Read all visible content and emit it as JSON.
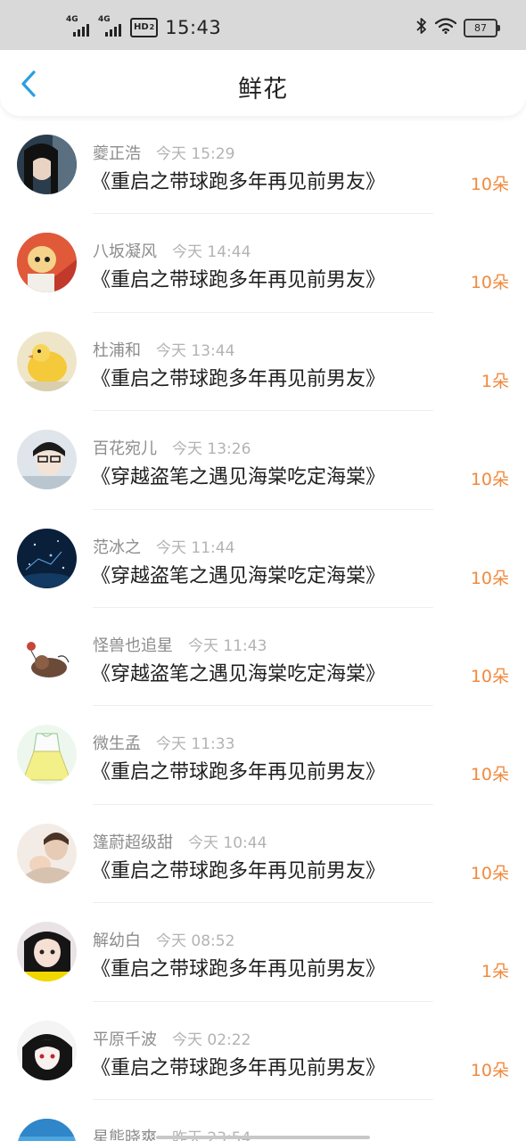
{
  "status_bar": {
    "signal_1": "4G",
    "signal_2": "4G",
    "hd": "HD",
    "hd_sub": "2",
    "time": "15:43",
    "battery": "87",
    "icons": [
      "bluetooth-icon",
      "wifi-icon",
      "battery-icon"
    ]
  },
  "header": {
    "title": "鲜花",
    "back_icon": "chevron-left-icon",
    "accent_color": "#2a9fe0"
  },
  "colors": {
    "count": "#f08a3e",
    "username": "#8c8c8c",
    "time": "#b3b3b3"
  },
  "gifts": [
    {
      "user": "夔正浩",
      "time": "今天 15:29",
      "book": "《重启之带球跑多年再见前男友》",
      "count": "10朵"
    },
    {
      "user": "八坂凝风",
      "time": "今天 14:44",
      "book": "《重启之带球跑多年再见前男友》",
      "count": "10朵"
    },
    {
      "user": "杜浦和",
      "time": "今天 13:44",
      "book": "《重启之带球跑多年再见前男友》",
      "count": "1朵"
    },
    {
      "user": "百花宛儿",
      "time": "今天 13:26",
      "book": "《穿越盗笔之遇见海棠吃定海棠》",
      "count": "10朵"
    },
    {
      "user": "范冰之",
      "time": "今天 11:44",
      "book": "《穿越盗笔之遇见海棠吃定海棠》",
      "count": "10朵"
    },
    {
      "user": "怪兽也追星",
      "time": "今天 11:43",
      "book": "《穿越盗笔之遇见海棠吃定海棠》",
      "count": "10朵"
    },
    {
      "user": "微生孟",
      "time": "今天 11:33",
      "book": "《重启之带球跑多年再见前男友》",
      "count": "10朵"
    },
    {
      "user": "篷蔚超级甜",
      "time": "今天 10:44",
      "book": "《重启之带球跑多年再见前男友》",
      "count": "10朵"
    },
    {
      "user": "解幼白",
      "time": "今天 08:52",
      "book": "《重启之带球跑多年再见前男友》",
      "count": "1朵"
    },
    {
      "user": "平原千波",
      "time": "今天 02:22",
      "book": "《重启之带球跑多年再见前男友》",
      "count": "10朵"
    },
    {
      "user": "星熊晓爽",
      "time": "昨天 23:54",
      "book": "",
      "count": ""
    }
  ]
}
